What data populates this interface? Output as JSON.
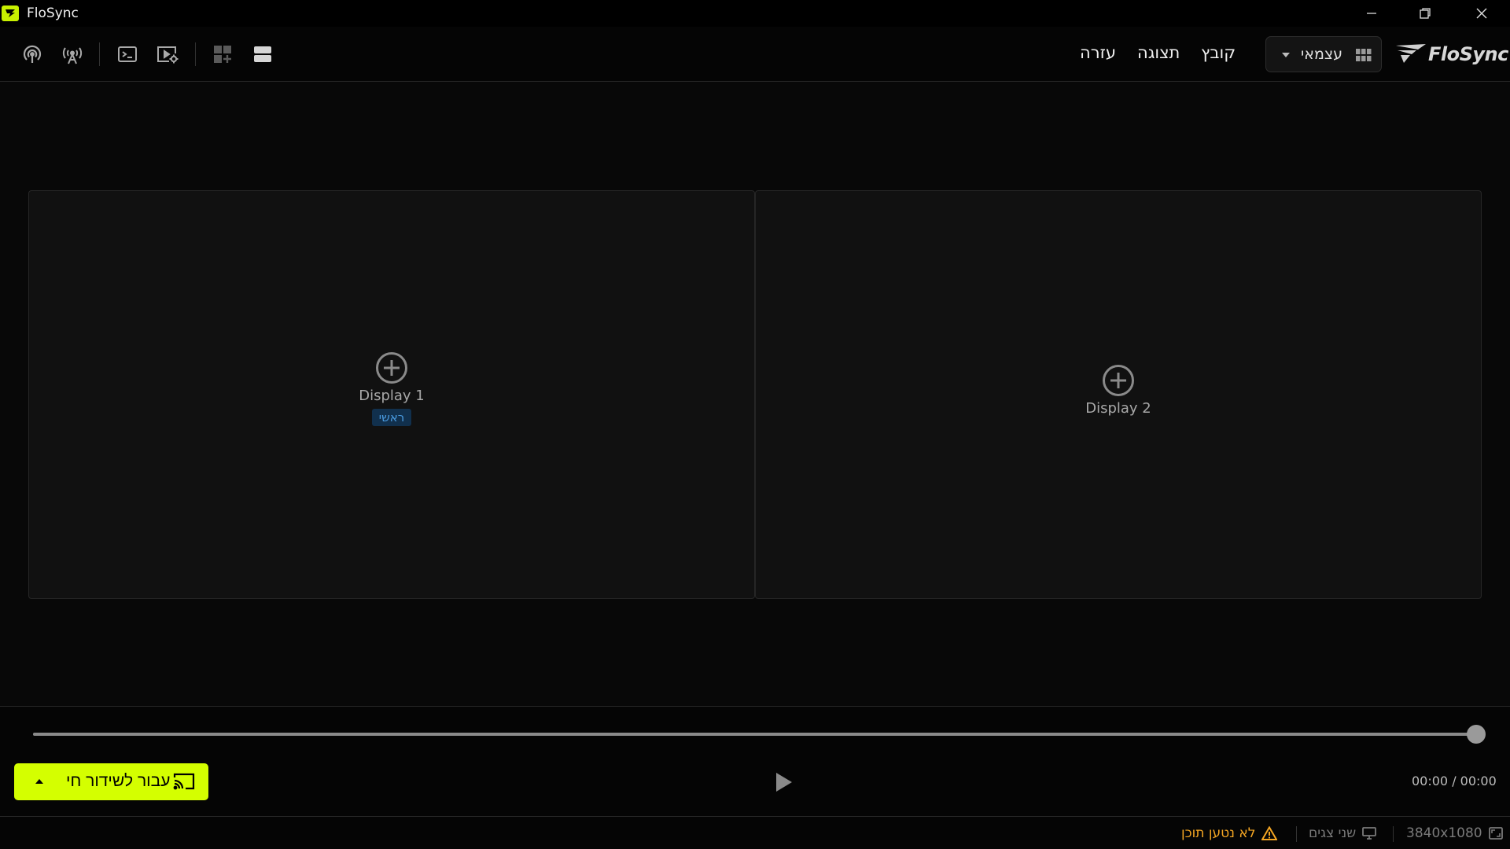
{
  "window": {
    "title": "FloSync",
    "controls": [
      "minimize-icon",
      "restore-icon",
      "close-icon"
    ]
  },
  "toolbar": {
    "left_icons": [
      "podcast-icon",
      "broadcast-tower-icon",
      "terminal-icon",
      "video-settings-icon",
      "add-grid-icon",
      "rows-layout-icon"
    ],
    "menu": {
      "file": "קובץ",
      "view": "תצוגה",
      "help": "עזרה"
    },
    "mode_select": {
      "selected": "עצמאי",
      "icon": "grid-icon"
    },
    "logo_text": "FloSync"
  },
  "displays": [
    {
      "name": "Display 1",
      "badge": "ראשי",
      "icon": "add-circle-icon"
    },
    {
      "name": "Display 2",
      "icon": "add-circle-icon"
    }
  ],
  "player": {
    "progress": 1.0,
    "time": "00:00 / 00:00",
    "play_icon": "play-icon",
    "live_button": {
      "label": "עבור לשידור חי",
      "icon": "cast-icon",
      "caret_icon": "caret-up-icon"
    }
  },
  "status": {
    "resolution": "3840x1080",
    "resolution_icon": "aspect-ratio-icon",
    "screens": "שני צגים",
    "screens_icon": "monitor-icon",
    "warning": "לא נטען תוכן",
    "warning_icon": "warning-icon"
  },
  "colors": {
    "accent": "#d4ff00",
    "warning": "#f5a623",
    "badge_bg": "#11304d",
    "badge_text": "#4a9be0",
    "background": "#080808",
    "panel": "#111111"
  }
}
